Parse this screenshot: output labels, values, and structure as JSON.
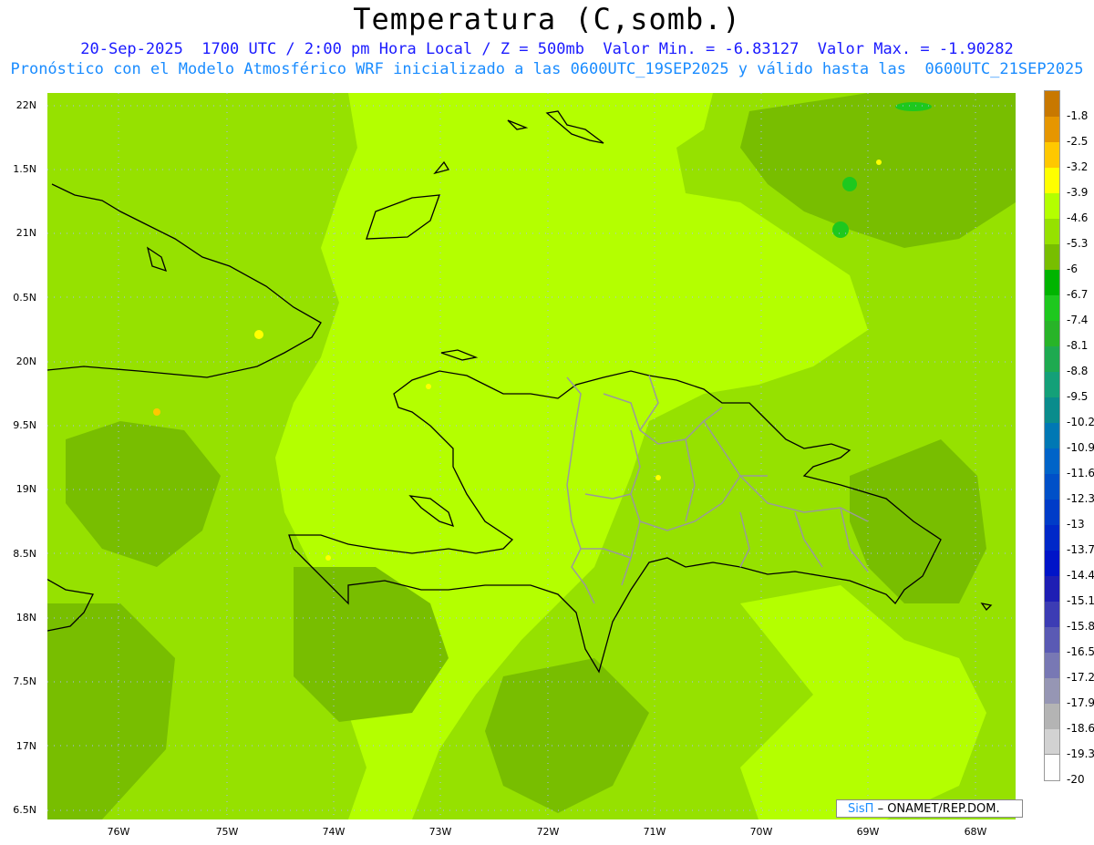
{
  "title": "Temperatura (C,somb.)",
  "subtitle_1": "20-Sep-2025  1700 UTC / 2:00 pm Hora Local / Z = 500mb  Valor Min. = -6.83127  Valor Max. = -1.90282",
  "subtitle_2": "Pronóstico con el Modelo Atmosférico WRF inicializado a las 0600UTC_19SEP2025 y válido hasta las  0600UTC_21SEP2025",
  "credit": {
    "brand": "SisΠ",
    "text": "– ONAMET/REP.DOM."
  },
  "axes": {
    "y_ticks": [
      "22N",
      "1.5N",
      "21N",
      "0.5N",
      "20N",
      "9.5N",
      "19N",
      "8.5N",
      "18N",
      "7.5N",
      "17N",
      "6.5N"
    ],
    "x_ticks": [
      "76W",
      "75W",
      "74W",
      "73W",
      "72W",
      "71W",
      "70W",
      "69W",
      "68W"
    ]
  },
  "colorbar": {
    "labels": [
      "-1.8",
      "-2.5",
      "-3.2",
      "-3.9",
      "-4.6",
      "-5.3",
      "-6",
      "-6.7",
      "-7.4",
      "-8.1",
      "-8.8",
      "-9.5",
      "-10.2",
      "-10.9",
      "-11.6",
      "-12.3",
      "-13",
      "-13.7",
      "-14.4",
      "-15.1",
      "-15.8",
      "-16.5",
      "-17.2",
      "-17.9",
      "-18.6",
      "-19.3",
      "-20"
    ],
    "colors": [
      "#c87800",
      "#e69600",
      "#ffc800",
      "#ffff00",
      "#b4ff00",
      "#96e100",
      "#78be00",
      "#00b400",
      "#1ec81e",
      "#28b428",
      "#1eaa50",
      "#14a078",
      "#0a8c8c",
      "#0078b4",
      "#0064c8",
      "#0050c8",
      "#003cc8",
      "#0028c8",
      "#0014c8",
      "#1e1eb4",
      "#3c3cb4",
      "#5a5ab4",
      "#7878b4",
      "#9696b4",
      "#b4b4b4",
      "#d2d2d2",
      "#ffffff"
    ]
  }
}
